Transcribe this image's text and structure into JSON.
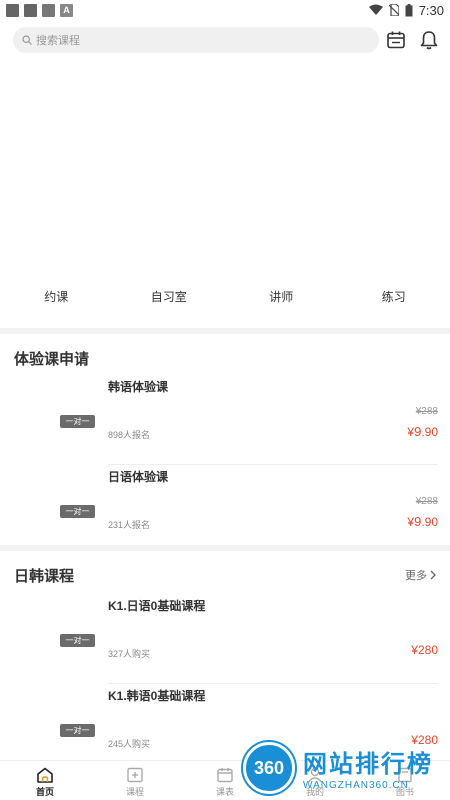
{
  "status": {
    "time": "7:30"
  },
  "search": {
    "placeholder": "搜索课程"
  },
  "quick_nav": [
    "约课",
    "自习室",
    "讲师",
    "练习"
  ],
  "sections": {
    "trial": {
      "title": "体验课申请",
      "items": [
        {
          "tag": "一对一",
          "name": "韩语体验课",
          "count": "898人报名",
          "orig_price": "¥288",
          "price_symbol": "¥",
          "price_int": "9",
          "price_dec": ".90"
        },
        {
          "tag": "一对一",
          "name": "日语体验课",
          "count": "231人报名",
          "orig_price": "¥288",
          "price_symbol": "¥",
          "price_int": "9",
          "price_dec": ".90"
        }
      ]
    },
    "courses": {
      "title": "日韩课程",
      "more": "更多",
      "items": [
        {
          "tag": "一对一",
          "name": "K1.日语0基础课程",
          "count": "327人购买",
          "price": "¥280"
        },
        {
          "tag": "一对一",
          "name": "K1.韩语0基础课程",
          "count": "245人购买",
          "price": "¥280"
        }
      ]
    }
  },
  "bottom_nav": [
    "首页",
    "课程",
    "课表",
    "我的",
    "图书"
  ],
  "watermark": {
    "badge": "360",
    "name": "网站排行榜",
    "url": "WANGZHAN360.CN"
  },
  "colors": {
    "price": "#e8442a",
    "watermark": "#1a8fd6"
  }
}
